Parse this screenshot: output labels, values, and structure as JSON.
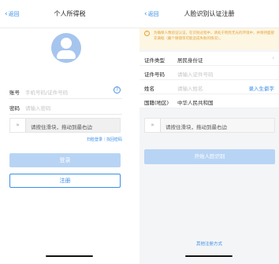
{
  "left": {
    "nav": {
      "back_label": "返回",
      "title": "个人所得税"
    },
    "account": {
      "label": "账号",
      "placeholder": "手机号码/证件号码"
    },
    "password": {
      "label": "密码",
      "placeholder": "请输入密码"
    },
    "slider": {
      "handle": "»",
      "text": "请按住滑块，拖动到最右边"
    },
    "links": "扫脸登录｜找回密码",
    "login_label": "登录",
    "register_label": "注册"
  },
  "right": {
    "nav": {
      "back_label": "返回",
      "title": "人脸识别认证注册"
    },
    "notice": "为确保人像验证认证，在识别过程中，请处于明亮无光的环境中，并保持面部充满框（戴个眼镜等可能造成失败的情况）。",
    "rows": [
      {
        "label": "证件类型",
        "value": "居民身份证",
        "arrow": "›"
      },
      {
        "label": "证件号码",
        "placeholder": "请输入证件号码"
      },
      {
        "label": "姓名",
        "placeholder": "请输入姓名",
        "link": "录入生僻字"
      },
      {
        "label": "国籍(地区)",
        "value": "中华人民共和国"
      }
    ],
    "slider": {
      "handle": "»",
      "text": "请按住滑块，拖动到最右边"
    },
    "start_label": "开始人脸识别",
    "other_label": "其他注册方式"
  },
  "colors": {
    "accent": "#3a8ee6",
    "disabled_button": "#b8d4f4",
    "notice_bg": "#fdf6e3",
    "notice_text": "#e2a33a"
  },
  "icons": {
    "help": "question-circle-icon",
    "back": "chevron-left-icon",
    "slider": "double-chevron-right-icon",
    "warning": "info-circle-icon"
  }
}
